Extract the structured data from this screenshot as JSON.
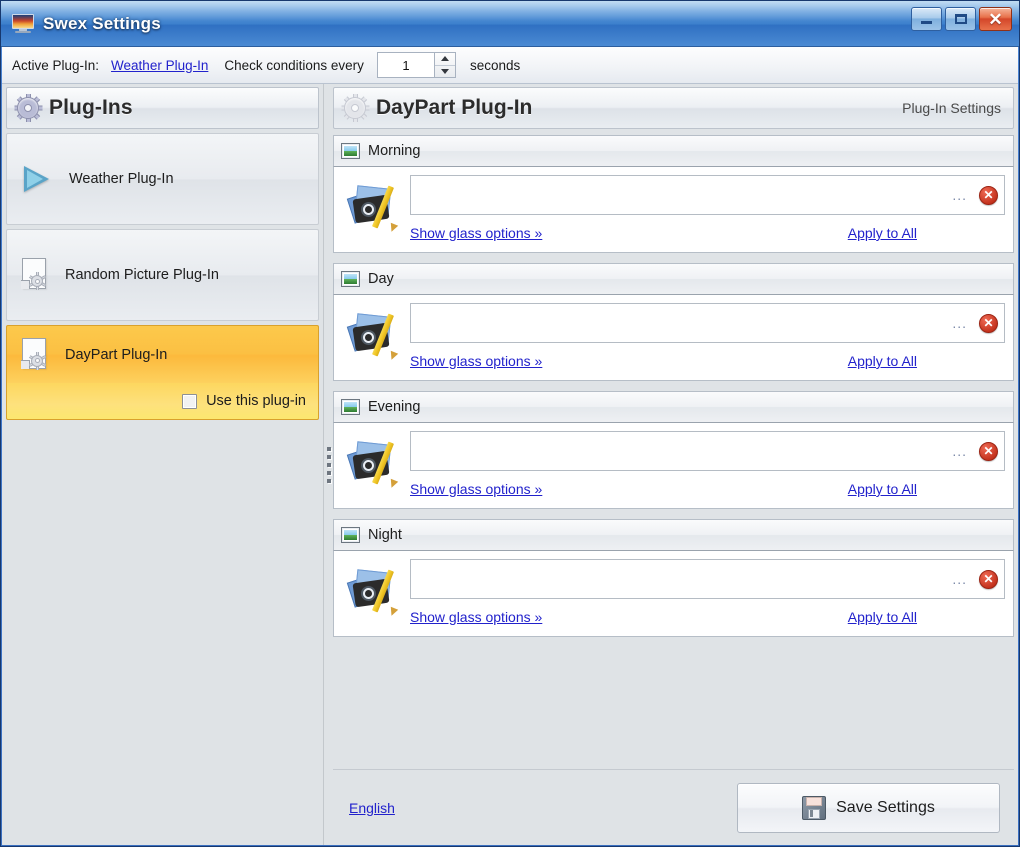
{
  "window": {
    "title": "Swex Settings",
    "icon": "monitor-wallpaper-icon",
    "buttons": {
      "minimize": "–",
      "maximize": "□",
      "close": "✕"
    }
  },
  "toolbar": {
    "active_plugin_label": "Active Plug-In:",
    "active_plugin_link": "Weather Plug-In",
    "check_label": "Check conditions every",
    "interval_value": "1",
    "seconds_label": "seconds"
  },
  "sidebar": {
    "header_title": "Plug-Ins",
    "header_icon": "gear-icon",
    "items": [
      {
        "label": "Weather Plug-In",
        "icon": "blue-arrow-icon",
        "selected": false
      },
      {
        "label": "Random Picture Plug-In",
        "icon": "document-gear-icon",
        "selected": false
      },
      {
        "label": "DayPart Plug-In",
        "icon": "document-gear-icon",
        "selected": true
      }
    ],
    "use_plugin_label": "Use this plug-in",
    "use_plugin_checked": false
  },
  "main": {
    "header_title": "DayPart Plug-In",
    "header_icon": "gear-icon-pale",
    "header_subtitle": "Plug-In Settings",
    "sections": [
      {
        "title": "Morning",
        "icon": "picture-icon",
        "path_value": "",
        "path_placeholder": "",
        "browse_label": "...",
        "delete_label": "✕",
        "glass_link": "Show glass options »",
        "apply_link": "Apply to All"
      },
      {
        "title": "Day",
        "icon": "picture-icon",
        "path_value": "",
        "path_placeholder": "",
        "browse_label": "...",
        "delete_label": "✕",
        "glass_link": "Show glass options »",
        "apply_link": "Apply to All"
      },
      {
        "title": "Evening",
        "icon": "picture-icon",
        "path_value": "",
        "path_placeholder": "",
        "browse_label": "...",
        "delete_label": "✕",
        "glass_link": "Show glass options »",
        "apply_link": "Apply to All"
      },
      {
        "title": "Night",
        "icon": "picture-icon",
        "path_value": "",
        "path_placeholder": "",
        "browse_label": "...",
        "delete_label": "✕",
        "glass_link": "Show glass options »",
        "apply_link": "Apply to All"
      }
    ]
  },
  "footer": {
    "language_link": "English",
    "save_label": "Save Settings",
    "save_icon": "floppy-disk-icon"
  },
  "colors": {
    "titlebar_blue": "#3b7fcc",
    "selection_yellow": "#fbc043",
    "link_blue": "#2222cc",
    "close_red": "#d4472a",
    "delete_red": "#c2301b"
  }
}
